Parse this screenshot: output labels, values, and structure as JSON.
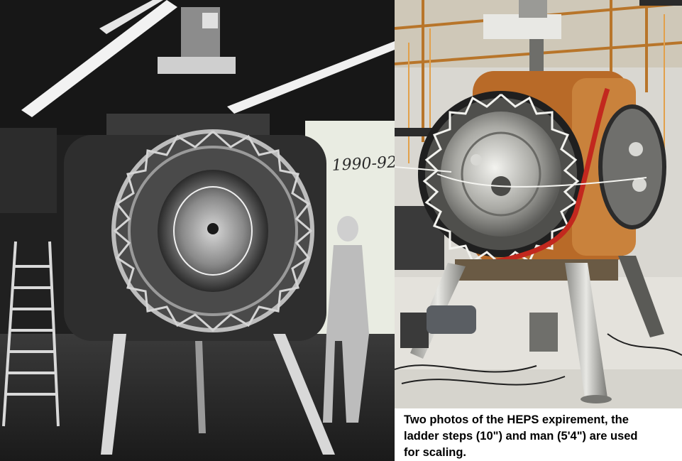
{
  "left_photo": {
    "handwritten_label": "1990-92",
    "tone": "black-and-white"
  },
  "right_photo": {
    "tone": "color"
  },
  "caption": {
    "text": "Two photos of the HEPS expirement, the\nladder steps (10\") and man (5'4\") are used\nfor scaling."
  },
  "colors": {
    "background": "#ffffff",
    "caption_text": "#000000",
    "left_photo_base": "#1c1c1c",
    "right_photo_base": "#c9c6bf"
  }
}
